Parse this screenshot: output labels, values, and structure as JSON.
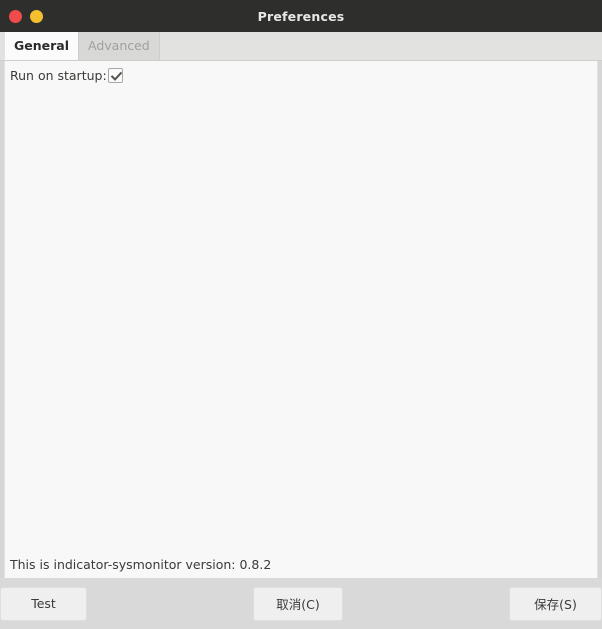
{
  "window": {
    "title": "Preferences",
    "controls": [
      {
        "name": "close",
        "icon": "close-circle-icon",
        "color": "#ef4b4b"
      },
      {
        "name": "minimize",
        "icon": "minimize-circle-icon",
        "color": "#f5c030"
      }
    ]
  },
  "tabs": [
    {
      "label": "General",
      "active": true
    },
    {
      "label": "Advanced",
      "active": false
    }
  ],
  "general": {
    "run_on_startup": {
      "label": "Run on startup:",
      "checked": true,
      "check_glyph": "checkmark-icon"
    }
  },
  "status": {
    "text": "This is indicator-sysmonitor version: 0.8.2"
  },
  "footer": {
    "test_label": "Test",
    "cancel_label": "取消(C)",
    "save_label": "保存(S)"
  },
  "colors": {
    "titlebar_bg": "#2e2e2c",
    "titlebar_fg": "#e8e8e6",
    "window_bg": "#d6d6d6",
    "page_bg": "#f8f8f8",
    "tabstrip_bg": "#e2e2e0",
    "active_tab_bg": "#fbfbfb",
    "inactive_tab_fg": "#a0a09e",
    "footer_bg": "#d9d9d9",
    "button_bg": "#efefef",
    "text_fg": "#3a3a38"
  }
}
